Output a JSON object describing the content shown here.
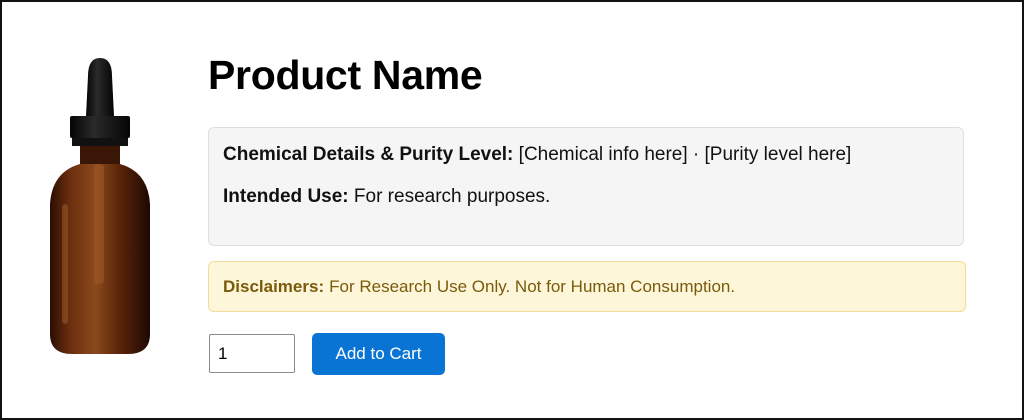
{
  "product": {
    "image_icon": "amber-dropper-bottle",
    "title": "Product Name"
  },
  "details": {
    "chemical_label": "Chemical Details & Purity Level:",
    "chemical_value": "[Chemical info here] · [Purity level here]",
    "use_label": "Intended Use:",
    "use_value": "For research purposes."
  },
  "disclaimer": {
    "label": "Disclaimers:",
    "text": "For Research Use Only. Not for Human Consumption."
  },
  "cart": {
    "quantity": "1",
    "add_label": "Add to Cart"
  },
  "colors": {
    "button": "#0a74d4",
    "disclaimer_bg": "#fdf6d9",
    "disclaimer_text": "#7a5a0b",
    "details_bg": "#f5f5f5"
  }
}
